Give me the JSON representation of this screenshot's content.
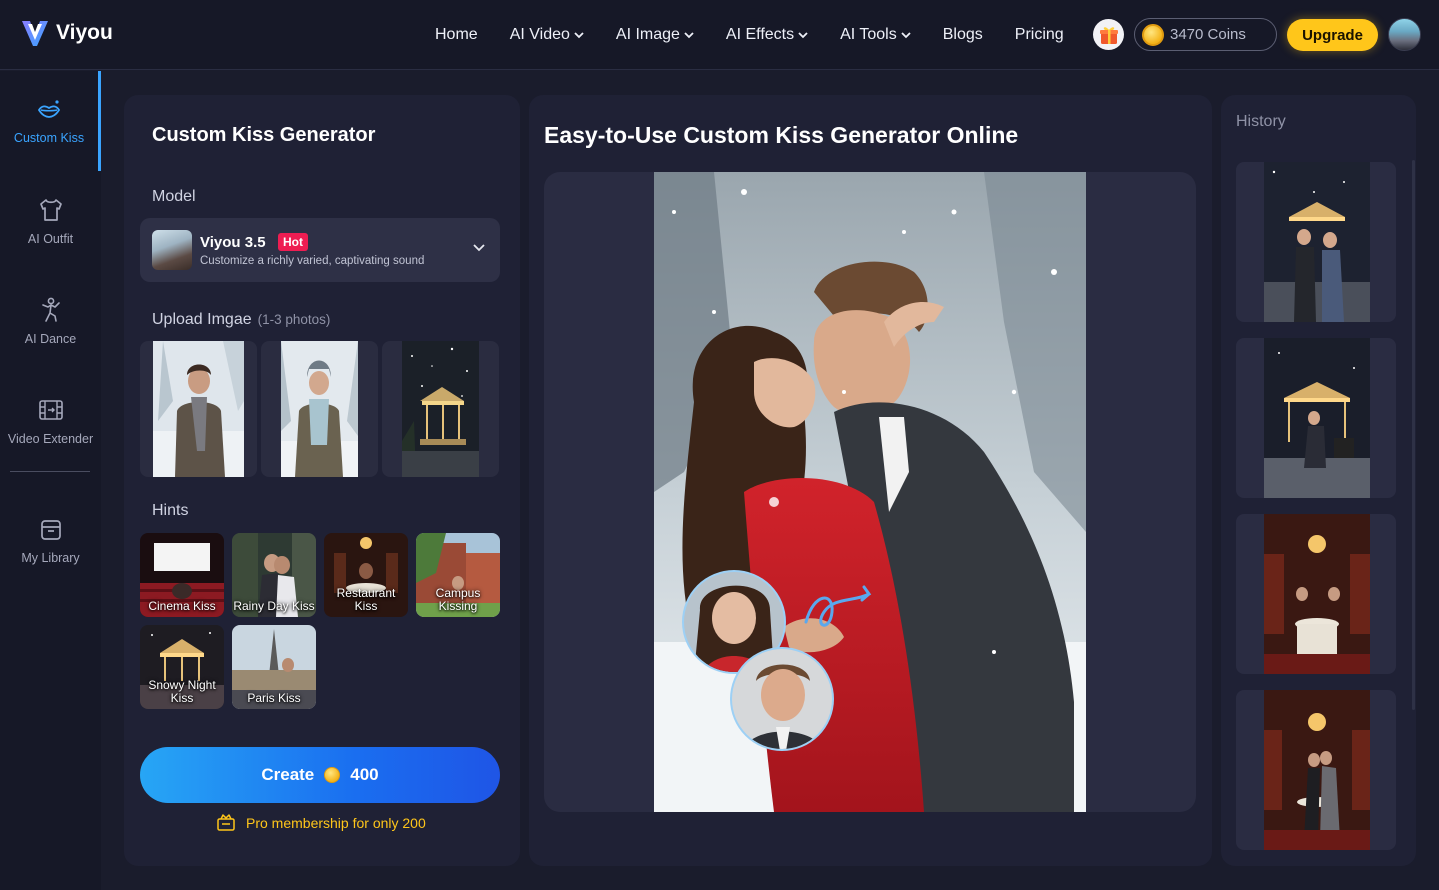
{
  "app": {
    "name": "Viyou"
  },
  "nav": {
    "items": [
      {
        "label": "Home",
        "dropdown": false
      },
      {
        "label": "AI Video",
        "dropdown": true
      },
      {
        "label": "AI Image",
        "dropdown": true
      },
      {
        "label": "AI Effects",
        "dropdown": true
      },
      {
        "label": "AI Tools",
        "dropdown": true
      },
      {
        "label": "Blogs",
        "dropdown": false
      },
      {
        "label": "Pricing",
        "dropdown": false
      }
    ],
    "coins_label": "3470 Coins",
    "upgrade_label": "Upgrade"
  },
  "sidebar": {
    "items": [
      {
        "label": "Custom Kiss",
        "icon": "kiss-lips-icon",
        "active": true
      },
      {
        "label": "AI Outfit",
        "icon": "shirt-icon",
        "active": false
      },
      {
        "label": "AI Dance",
        "icon": "dance-figure-icon",
        "active": false
      },
      {
        "label": "Video Extender",
        "icon": "film-extend-icon",
        "active": false
      },
      {
        "label": "My Library",
        "icon": "archive-box-icon",
        "active": false
      }
    ]
  },
  "generator": {
    "title": "Custom Kiss Generator",
    "model_label": "Model",
    "model": {
      "name": "Viyou 3.5",
      "badge": "Hot",
      "description": "Customize a richly varied, captivating sound"
    },
    "upload_label": "Upload Imgae",
    "upload_sub": "(1-3 photos)",
    "hints_label": "Hints",
    "hints": [
      {
        "label": "Cinema Kiss"
      },
      {
        "label": "Rainy Day Kiss"
      },
      {
        "label": "Restaurant Kiss"
      },
      {
        "label": "Campus Kissing"
      },
      {
        "label": "Snowy Night Kiss"
      },
      {
        "label": "Paris Kiss"
      }
    ],
    "create_label": "Create",
    "create_cost": "400",
    "pro_text": "Pro membership for only 200"
  },
  "preview": {
    "title": "Easy-to-Use Custom Kiss Generator Online"
  },
  "history": {
    "label": "History"
  },
  "colors": {
    "accent": "#3aa4ff",
    "upgrade": "#ffc61a",
    "hot_badge": "#ee1d52",
    "background": "#1a1c2c"
  }
}
